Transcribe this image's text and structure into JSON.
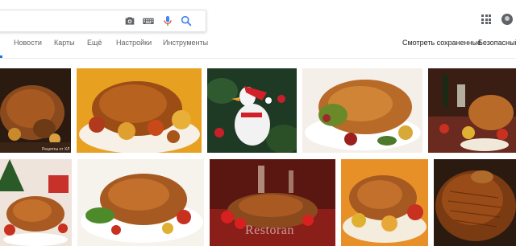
{
  "search": {
    "value": "",
    "icons": [
      "camera-icon",
      "keyboard-icon",
      "microphone-icon",
      "search-icon"
    ]
  },
  "nav": {
    "tabs": [
      {
        "label": "Новости"
      },
      {
        "label": "Карты"
      },
      {
        "label": "Ещё"
      },
      {
        "label": "Настройки"
      },
      {
        "label": "Инструменты"
      }
    ],
    "saved": "Смотреть сохраненные",
    "safe": "Безопасный"
  },
  "header": {
    "apps_icon": "apps-grid-icon",
    "account_icon": "account-avatar-icon"
  },
  "images": [
    {
      "alt": "roast goose on tray"
    },
    {
      "alt": "roast duck with apples"
    },
    {
      "alt": "white goose toy with santa hat"
    },
    {
      "alt": "stuffed roast goose on platter"
    },
    {
      "alt": "christmas table with roast bird"
    },
    {
      "alt": "christmas roast with decorations"
    },
    {
      "alt": "roast duck with vegetables"
    },
    {
      "alt": "roast goose on red table"
    },
    {
      "alt": "roast duck with apples on plate"
    },
    {
      "alt": "crispy roast bird close-up"
    }
  ],
  "watermarks": {
    "small": "Рецепты от ХЛ",
    "restoran": "Restoran"
  },
  "colors": {
    "accent": "#1a73e8",
    "mic_blue": "#4285f4",
    "mic_red": "#ea4335"
  }
}
